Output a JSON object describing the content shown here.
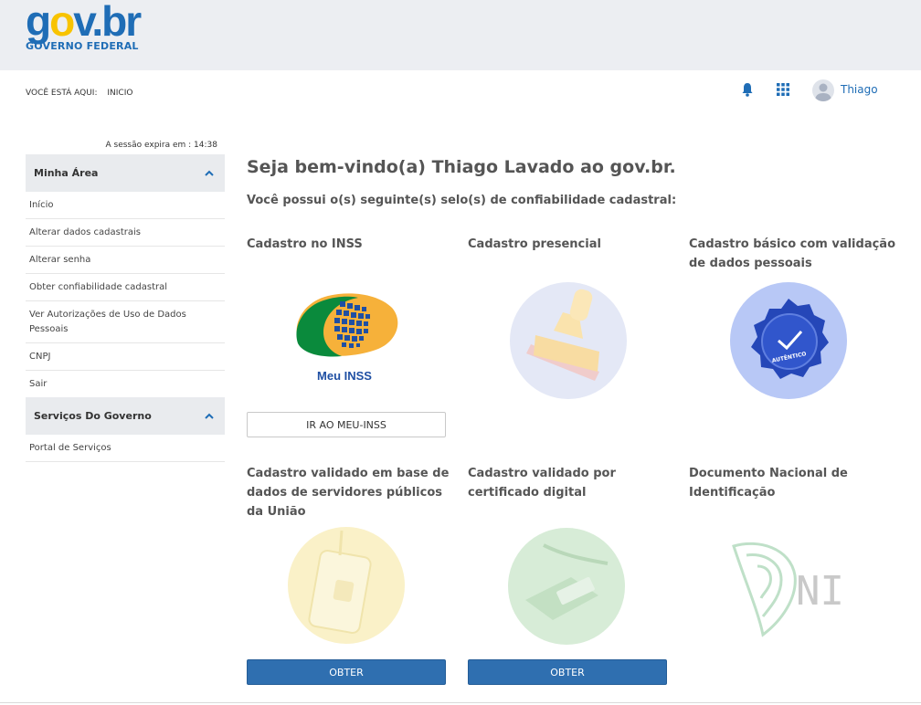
{
  "header": {
    "logo": {
      "part1": "g",
      "part2": "o",
      "part3": "v",
      "dot": ".",
      "part4": "br"
    },
    "subtitle": "GOVERNO FEDERAL"
  },
  "breadcrumb": {
    "label": "VOCÊ ESTÁ AQUI:",
    "current": "INICIO"
  },
  "user": {
    "name": "Thiago"
  },
  "session": "A sessão expira em : 14:38",
  "sidebar": {
    "section1": {
      "title": "Minha Área",
      "items": [
        "Início",
        "Alterar dados cadastrais",
        "Alterar senha",
        "Obter confiabilidade cadastral",
        "Ver Autorizações de Uso de Dados Pessoais",
        "CNPJ",
        "Sair"
      ]
    },
    "section2": {
      "title": "Serviços Do Governo",
      "items": [
        "Portal de Serviços"
      ]
    }
  },
  "main": {
    "welcome": "Seja bem-vindo(a) Thiago Lavado ao gov.br.",
    "subtitle": "Você possui o(s) seguinte(s) selo(s) de confiabilidade cadastral:",
    "cards": [
      {
        "title": "Cadastro no INSS",
        "seal_label": "Meu INSS",
        "button": "IR AO MEU-INSS"
      },
      {
        "title": "Cadastro presencial"
      },
      {
        "title": "Cadastro básico com validação de dados pessoais",
        "seal_label": "AUTÊNTICO"
      },
      {
        "title": "Cadastro validado em base de dados de servidores públicos da União",
        "button": "OBTER"
      },
      {
        "title": "Cadastro validado por certificado digital",
        "button": "OBTER"
      },
      {
        "title": "Documento Nacional de Identificação",
        "seal_label": "NI"
      }
    ]
  },
  "colors": {
    "brand_blue": "#1f6db6",
    "brand_yellow": "#f8c300",
    "button_blue": "#2f6fb0"
  }
}
